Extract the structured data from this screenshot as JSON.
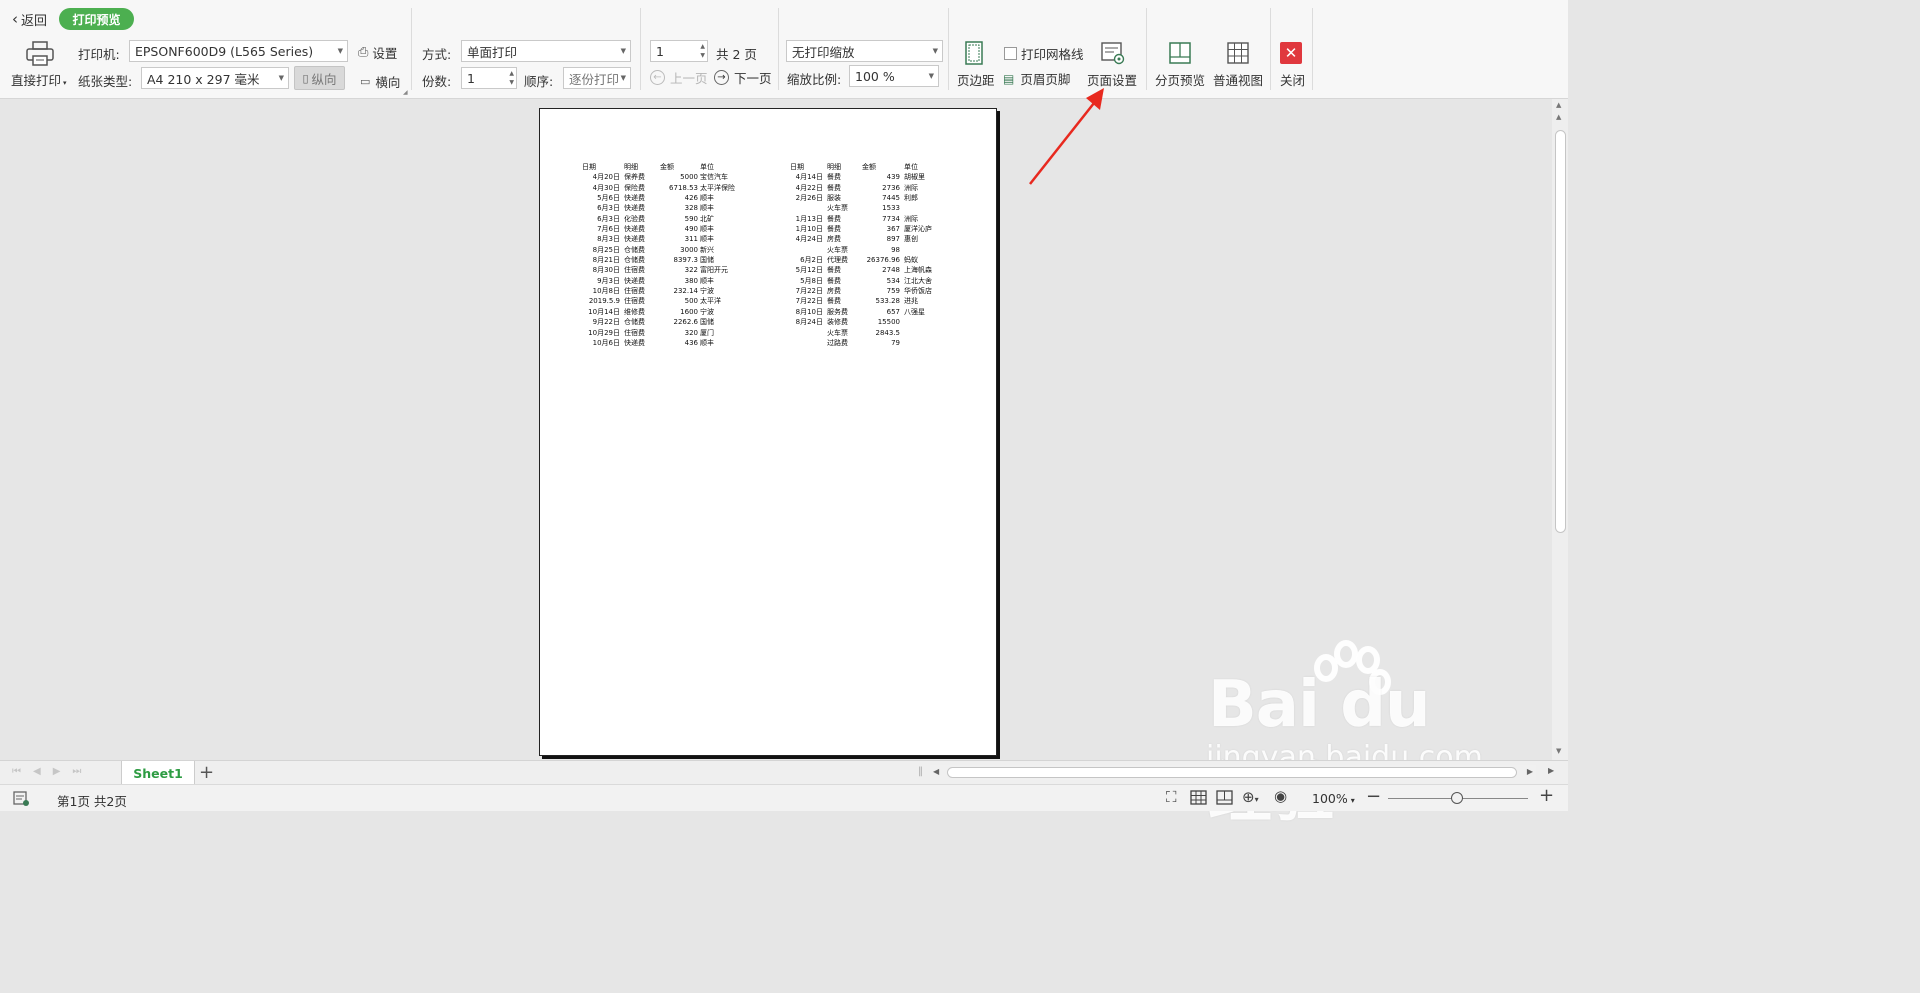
{
  "toolbar": {
    "back_label": "返回",
    "mode_badge": "打印预览",
    "direct_print_label": "直接打印",
    "printer_label": "打印机:",
    "printer_value": "EPSONF600D9 (L565 Series)",
    "paper_type_label": "纸张类型:",
    "paper_type_value": "A4 210 x 297 毫米",
    "portrait_label": "纵向",
    "landscape_label": "横向",
    "settings_label": "设置",
    "method_label": "方式:",
    "method_value": "单面打印",
    "copies_label": "份数:",
    "copies_value": "1",
    "order_label": "顺序:",
    "order_value": "逐份打印",
    "page_input_value": "1",
    "total_pages_label": "共 2 页",
    "prev_page_label": "上一页",
    "next_page_label": "下一页",
    "scaling_value": "无打印缩放",
    "scale_ratio_label": "缩放比例:",
    "scale_ratio_value": "100 %",
    "margins_label": "页边距",
    "print_gridlines_label": "打印网格线",
    "header_footer_label": "页眉页脚",
    "page_setup_label": "页面设置",
    "page_break_preview_label": "分页预览",
    "normal_view_label": "普通视图",
    "close_label": "关闭"
  },
  "preview": {
    "left_table": {
      "headers": [
        "日期",
        "明细",
        "金额",
        "单位"
      ],
      "rows": [
        [
          "4月20日",
          "保养费",
          "5000",
          "宝信汽车"
        ],
        [
          "4月30日",
          "保险费",
          "6718.53",
          "太平洋保险"
        ],
        [
          "5月6日",
          "快递费",
          "426",
          "顺丰"
        ],
        [
          "6月3日",
          "快递费",
          "328",
          "顺丰"
        ],
        [
          "6月3日",
          "化验费",
          "590",
          "北矿"
        ],
        [
          "7月6日",
          "快递费",
          "490",
          "顺丰"
        ],
        [
          "8月3日",
          "快递费",
          "311",
          "顺丰"
        ],
        [
          "8月25日",
          "仓储费",
          "3000",
          "新兴"
        ],
        [
          "8月21日",
          "仓储费",
          "8397.3",
          "国储"
        ],
        [
          "8月30日",
          "住宿费",
          "322",
          "富阳开元"
        ],
        [
          "9月3日",
          "快递费",
          "380",
          "顺丰"
        ],
        [
          "10月8日",
          "住宿费",
          "232.14",
          "宁波"
        ],
        [
          "2019.5.9",
          "住宿费",
          "500",
          "太平洋"
        ],
        [
          "10月14日",
          "维修费",
          "1600",
          "宁波"
        ],
        [
          "9月22日",
          "仓储费",
          "2262.6",
          "国储"
        ],
        [
          "10月29日",
          "住宿费",
          "320",
          "厦门"
        ],
        [
          "10月6日",
          "快递费",
          "436",
          "顺丰"
        ]
      ]
    },
    "right_table": {
      "headers": [
        "日期",
        "明细",
        "金额",
        "单位"
      ],
      "rows": [
        [
          "4月14日",
          "餐费",
          "439",
          "胡椒里"
        ],
        [
          "4月22日",
          "餐费",
          "2736",
          "洲际"
        ],
        [
          "2月26日",
          "服装",
          "7445",
          "利郎"
        ],
        [
          "",
          "火车票",
          "1533",
          ""
        ],
        [
          "1月13日",
          "餐费",
          "7734",
          "洲际"
        ],
        [
          "1月10日",
          "餐费",
          "367",
          "厦洋沁庐"
        ],
        [
          "4月24日",
          "房费",
          "897",
          "惠创"
        ],
        [
          "",
          "火车票",
          "98",
          ""
        ],
        [
          "6月2日",
          "代理费",
          "26376.96",
          "蚂蚁"
        ],
        [
          "5月12日",
          "餐费",
          "2748",
          "上海帆森"
        ],
        [
          "5月8日",
          "餐费",
          "534",
          "江北大舍"
        ],
        [
          "7月22日",
          "房费",
          "759",
          "华侨饭店"
        ],
        [
          "7月22日",
          "餐费",
          "533.28",
          "进兆"
        ],
        [
          "8月10日",
          "服务费",
          "657",
          "八强星"
        ],
        [
          "8月24日",
          "装修费",
          "15500",
          ""
        ],
        [
          "",
          "火车票",
          "2843.5",
          ""
        ],
        [
          "",
          "过路费",
          "79",
          ""
        ]
      ]
    }
  },
  "sheet_tabs": [
    "Sheet1"
  ],
  "status": {
    "page_info": "第1页 共2页",
    "zoom_label": "100%"
  },
  "watermark": {
    "logo_text": "Bai du经验",
    "url": "jingyan.baidu.com"
  }
}
